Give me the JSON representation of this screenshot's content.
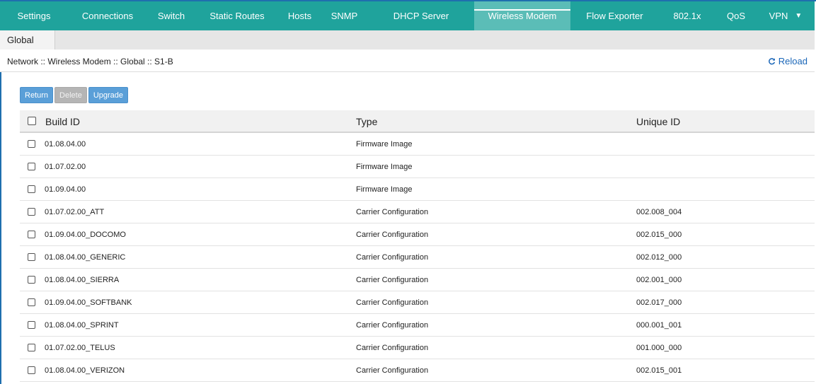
{
  "nav": {
    "items": [
      {
        "label": "Settings"
      },
      {
        "label": "Connections"
      },
      {
        "label": "Switch"
      },
      {
        "label": "Static Routes"
      },
      {
        "label": "Hosts"
      },
      {
        "label": "SNMP"
      },
      {
        "label": "DHCP Server"
      },
      {
        "label": "Wireless Modem"
      },
      {
        "label": "Flow Exporter"
      },
      {
        "label": "802.1x"
      },
      {
        "label": "QoS"
      },
      {
        "label": "VPN"
      }
    ],
    "active": "Wireless Modem"
  },
  "subtabs": {
    "active_label": "Global"
  },
  "breadcrumb": "Network :: Wireless Modem :: Global :: S1-B",
  "reload_label": "Reload",
  "actions": {
    "return_label": "Return",
    "delete_label": "Delete",
    "upgrade_label": "Upgrade"
  },
  "table": {
    "columns": {
      "build_id": "Build ID",
      "type": "Type",
      "unique_id": "Unique ID"
    },
    "rows": [
      {
        "build_id": "01.08.04.00",
        "type": "Firmware Image",
        "unique_id": ""
      },
      {
        "build_id": "01.07.02.00",
        "type": "Firmware Image",
        "unique_id": ""
      },
      {
        "build_id": "01.09.04.00",
        "type": "Firmware Image",
        "unique_id": ""
      },
      {
        "build_id": "01.07.02.00_ATT",
        "type": "Carrier Configuration",
        "unique_id": "002.008_004"
      },
      {
        "build_id": "01.09.04.00_DOCOMO",
        "type": "Carrier Configuration",
        "unique_id": "002.015_000"
      },
      {
        "build_id": "01.08.04.00_GENERIC",
        "type": "Carrier Configuration",
        "unique_id": "002.012_000"
      },
      {
        "build_id": "01.08.04.00_SIERRA",
        "type": "Carrier Configuration",
        "unique_id": "002.001_000"
      },
      {
        "build_id": "01.09.04.00_SOFTBANK",
        "type": "Carrier Configuration",
        "unique_id": "002.017_000"
      },
      {
        "build_id": "01.08.04.00_SPRINT",
        "type": "Carrier Configuration",
        "unique_id": "000.001_001"
      },
      {
        "build_id": "01.07.02.00_TELUS",
        "type": "Carrier Configuration",
        "unique_id": "001.000_000"
      },
      {
        "build_id": "01.08.04.00_VERIZON",
        "type": "Carrier Configuration",
        "unique_id": "002.015_001"
      }
    ]
  },
  "colors": {
    "nav_bg": "#1fa39c",
    "nav_active": "#5bbdb7",
    "button_blue": "#5a9fd8",
    "link_blue": "#1a66b8"
  }
}
